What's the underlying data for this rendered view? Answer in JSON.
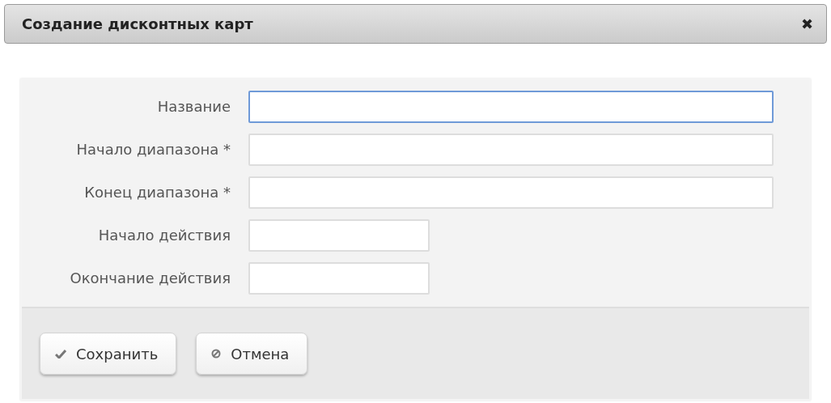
{
  "dialog": {
    "title": "Создание дисконтных карт",
    "close": "✖"
  },
  "fields": [
    {
      "label": "Название",
      "kind": "wide",
      "focused": true
    },
    {
      "label": "Начало диапазона *",
      "kind": "wide",
      "focused": false
    },
    {
      "label": "Конец диапазона *",
      "kind": "wide",
      "focused": false
    },
    {
      "label": "Начало действия",
      "kind": "short",
      "focused": false
    },
    {
      "label": "Окончание действия",
      "kind": "short",
      "focused": false
    }
  ],
  "buttons": [
    {
      "label": "Сохранить",
      "kind": "save"
    },
    {
      "label": "Отмена",
      "kind": "cancel"
    }
  ]
}
